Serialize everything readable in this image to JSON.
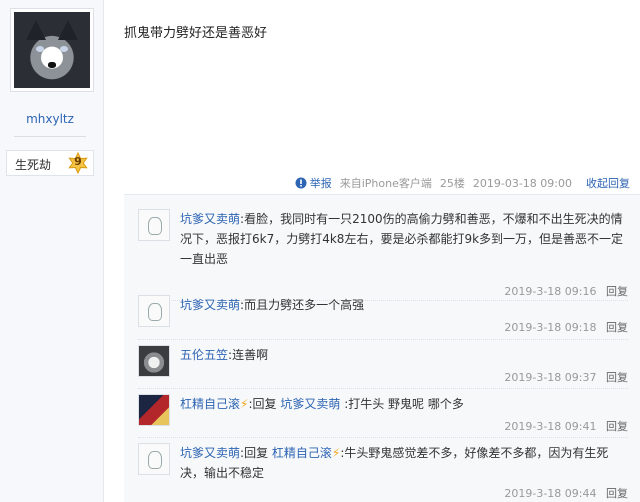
{
  "user": {
    "name": "mhxyltz",
    "level_title": "生死劫",
    "level": "9"
  },
  "post": {
    "text": "抓鬼带力劈好还是善恶好",
    "tail": {
      "report": "举报",
      "device": "来自iPhone客户端",
      "floor": "25楼",
      "time": "2019-03-18 09:00",
      "collapse": "收起回复"
    }
  },
  "replies": [
    {
      "user": "坑爹又卖萌",
      "text": "看脸，我同时有一只2100伤的高偷力劈和善恶，不爆和不出生死决的情况下，恶报打6k7，力劈打4k8左右，要是必杀都能打9k多到一万，但是善恶不一定一直出恶",
      "time": "2019-3-18 09:16",
      "reply_label": "回复"
    },
    {
      "user": "坑爹又卖萌",
      "text": "而且力劈还多一个高强",
      "time": "2019-3-18 09:18",
      "reply_label": "回复"
    },
    {
      "user": "五伦五笠",
      "text": "连善啊",
      "time": "2019-3-18 09:37",
      "reply_label": "回复"
    },
    {
      "user": "杠精自己滚",
      "reply_word": "回复",
      "target": "坑爹又卖萌",
      "text": ":打牛头 野鬼呢 哪个多",
      "time": "2019-3-18 09:41",
      "reply_label": "回复"
    },
    {
      "user": "坑爹又卖萌",
      "reply_word": "回复",
      "target": "杠精自己滚",
      "text": ":牛头野鬼感觉差不多，好像差不多都，因为有生死决，输出不稳定",
      "time": "2019-3-18 09:44",
      "reply_label": "回复"
    }
  ],
  "colors": {
    "link": "#2d64b3",
    "meta": "#999999",
    "reply_bg": "#f7f8fa",
    "badge": "#f5c343"
  },
  "icons": {
    "report": "alert-icon",
    "badge": "level-star-badge-icon",
    "flash": "lightning-icon"
  }
}
